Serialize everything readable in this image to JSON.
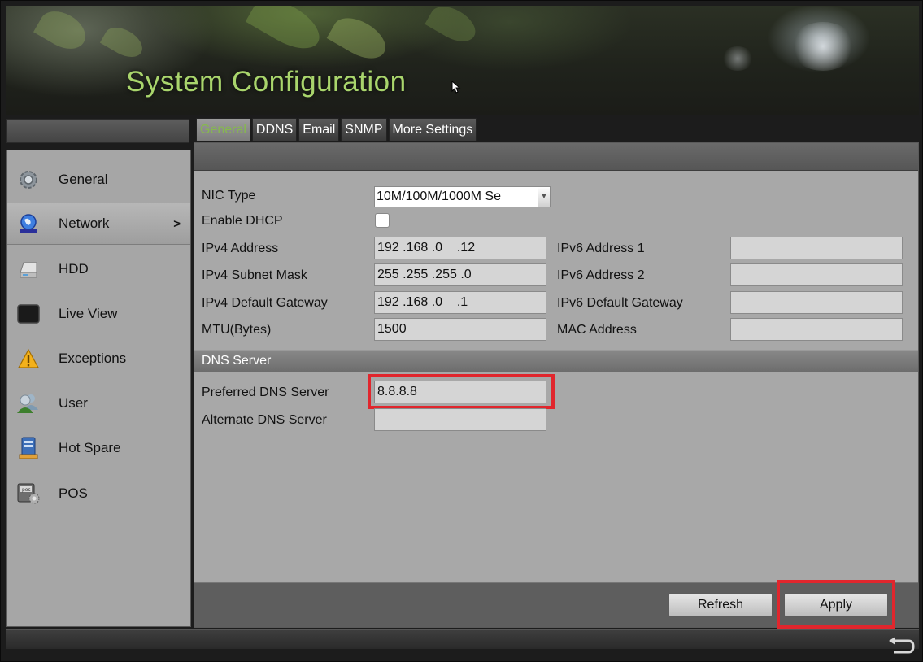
{
  "header": {
    "title": "System Configuration"
  },
  "sidebar": {
    "items": [
      {
        "label": "General",
        "icon": "gear-icon"
      },
      {
        "label": "Network",
        "icon": "globe-icon",
        "active": true,
        "arrow": ">"
      },
      {
        "label": "HDD",
        "icon": "hdd-icon"
      },
      {
        "label": "Live View",
        "icon": "monitor-icon"
      },
      {
        "label": "Exceptions",
        "icon": "warning-icon"
      },
      {
        "label": "User",
        "icon": "user-icon"
      },
      {
        "label": "Hot Spare",
        "icon": "hot-spare-icon"
      },
      {
        "label": "POS",
        "icon": "pos-icon"
      }
    ]
  },
  "tabs": [
    {
      "label": "General",
      "active": true
    },
    {
      "label": "DDNS"
    },
    {
      "label": "Email"
    },
    {
      "label": "SNMP"
    },
    {
      "label": "More Settings"
    }
  ],
  "general": {
    "nic_type": {
      "label": "NIC Type",
      "value": "10M/100M/1000M Se"
    },
    "enable_dhcp": {
      "label": "Enable DHCP",
      "checked": false
    },
    "ipv4_address": {
      "label": "IPv4 Address",
      "value": "192 .168 .0    .12"
    },
    "ipv4_subnet_mask": {
      "label": "IPv4 Subnet Mask",
      "value": "255 .255 .255 .0"
    },
    "ipv4_default_gateway": {
      "label": "IPv4 Default Gateway",
      "value": "192 .168 .0    .1"
    },
    "mtu": {
      "label": "MTU(Bytes)",
      "value": "1500"
    },
    "ipv6_address_1": {
      "label": "IPv6 Address 1",
      "value": ""
    },
    "ipv6_address_2": {
      "label": "IPv6 Address 2",
      "value": ""
    },
    "ipv6_default_gateway": {
      "label": "IPv6 Default Gateway",
      "value": ""
    },
    "mac_address": {
      "label": "MAC Address",
      "value": ""
    }
  },
  "dns": {
    "section_title": "DNS Server",
    "preferred": {
      "label": "Preferred DNS Server",
      "value": "8.8.8.8"
    },
    "alternate": {
      "label": "Alternate DNS Server",
      "value": ""
    }
  },
  "buttons": {
    "refresh": "Refresh",
    "apply": "Apply"
  },
  "colors": {
    "title_green": "#a9d56c",
    "active_tab_green": "#86b94e",
    "highlight_red": "#e1262d"
  }
}
